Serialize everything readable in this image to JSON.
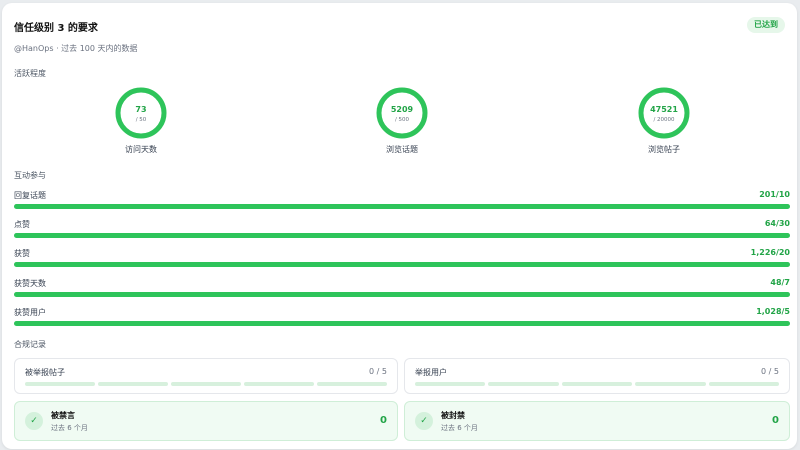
{
  "header": {
    "title": "信任级别 3 的要求",
    "status_badge": "已达到",
    "subtitle": "@HanOps · 过去 100 天内的数据"
  },
  "activity": {
    "section_label": "活跃程度",
    "rings": [
      {
        "value": "73",
        "target": "/ 50",
        "label": "访问天数",
        "progress": 1.0
      },
      {
        "value": "5209",
        "target": "/ 500",
        "label": "浏览话题",
        "progress": 1.0
      },
      {
        "value": "47521",
        "target": "/ 20000",
        "label": "浏览帖子",
        "progress": 1.0
      }
    ]
  },
  "engagement": {
    "section_label": "互动参与",
    "bars": [
      {
        "label": "回复话题",
        "value": "201/10",
        "progress": 1.0
      },
      {
        "label": "点赞",
        "value": "64/30",
        "progress": 1.0
      },
      {
        "label": "获赞",
        "value": "1,226/20",
        "progress": 1.0
      },
      {
        "label": "获赞天数",
        "value": "48/7",
        "progress": 1.0
      },
      {
        "label": "获赞用户",
        "value": "1,028/5",
        "progress": 1.0
      }
    ]
  },
  "compliance": {
    "section_label": "合规记录",
    "limits": [
      {
        "label": "被举报帖子",
        "value": "0 / 5"
      },
      {
        "label": "举报用户",
        "value": "0 / 5"
      }
    ],
    "records": [
      {
        "title": "被禁言",
        "period": "过去 6 个月",
        "count": "0"
      },
      {
        "title": "被封禁",
        "period": "过去 6 个月",
        "count": "0"
      }
    ]
  },
  "colors": {
    "accent": "#2ec45a",
    "accent_text": "#22a447",
    "track": "#d7f0dd"
  },
  "icons": {
    "check": "check-icon"
  }
}
